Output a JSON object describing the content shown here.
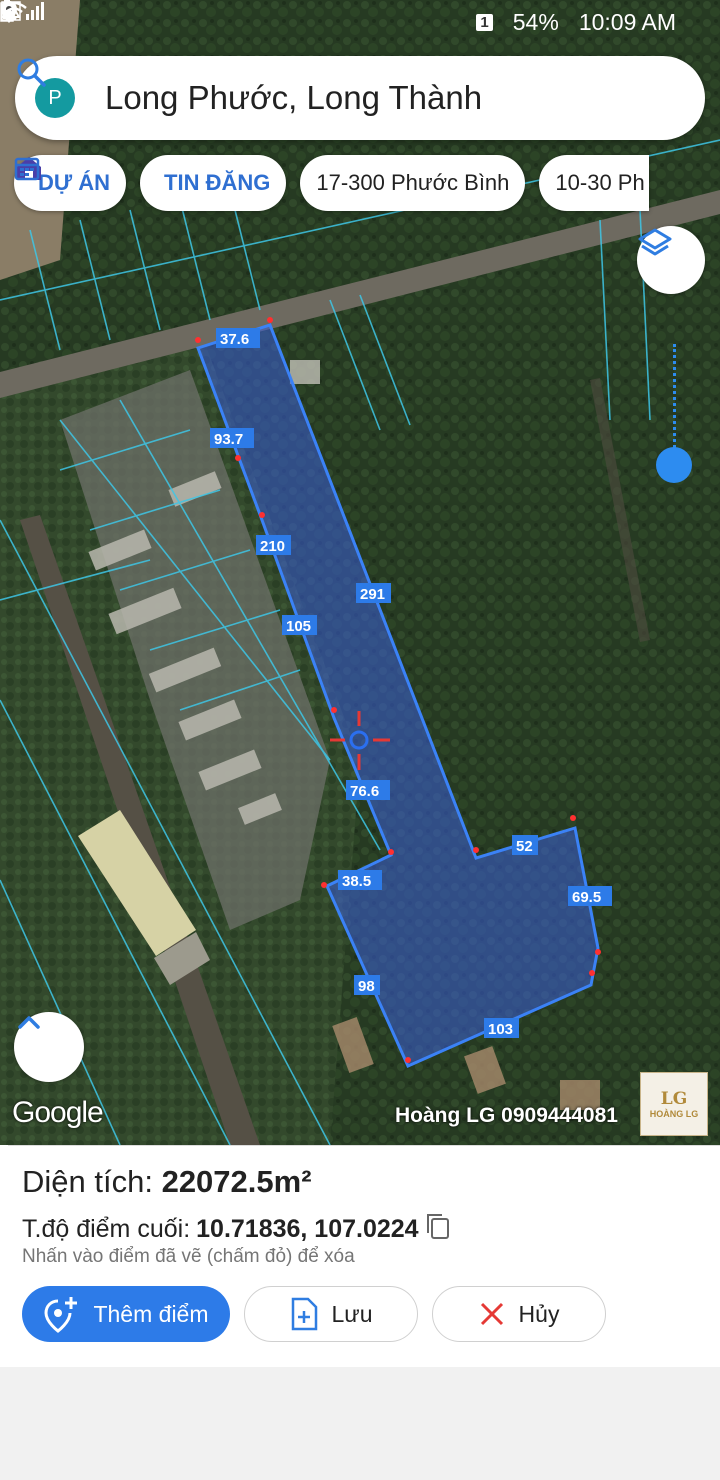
{
  "status": {
    "battery": "54%",
    "time": "10:09 AM",
    "sim": "1"
  },
  "search": {
    "avatar_letter": "P",
    "query": "Long Phước, Long Thành"
  },
  "chips": [
    {
      "label": "DỰ ÁN",
      "icon": "house-icon"
    },
    {
      "label": "TIN ĐĂNG",
      "icon": "calendar-icon"
    },
    {
      "label": "17-300 Phước Bình"
    },
    {
      "label": "10-30 Ph"
    }
  ],
  "map": {
    "google_label": "Google",
    "watermark": "Hoàng LG 0909444081",
    "logo_text": "LG",
    "logo_name": "HOÀNG LG",
    "edge_labels": [
      "37.6",
      "93.7",
      "210",
      "105",
      "291",
      "76.6",
      "52",
      "69.5",
      "38.5",
      "98",
      "103"
    ],
    "accent": "#2d7be8"
  },
  "sheet": {
    "area_label": "Diện tích:",
    "area_value": "22072.5m²",
    "coord_label": "T.độ điểm cuối:",
    "coord_value": "10.71836, 107.0224",
    "hint": "Nhấn vào điểm đã vẽ (chấm đỏ) để xóa",
    "add_label": "Thêm điểm",
    "save_label": "Lưu",
    "cancel_label": "Hủy"
  }
}
